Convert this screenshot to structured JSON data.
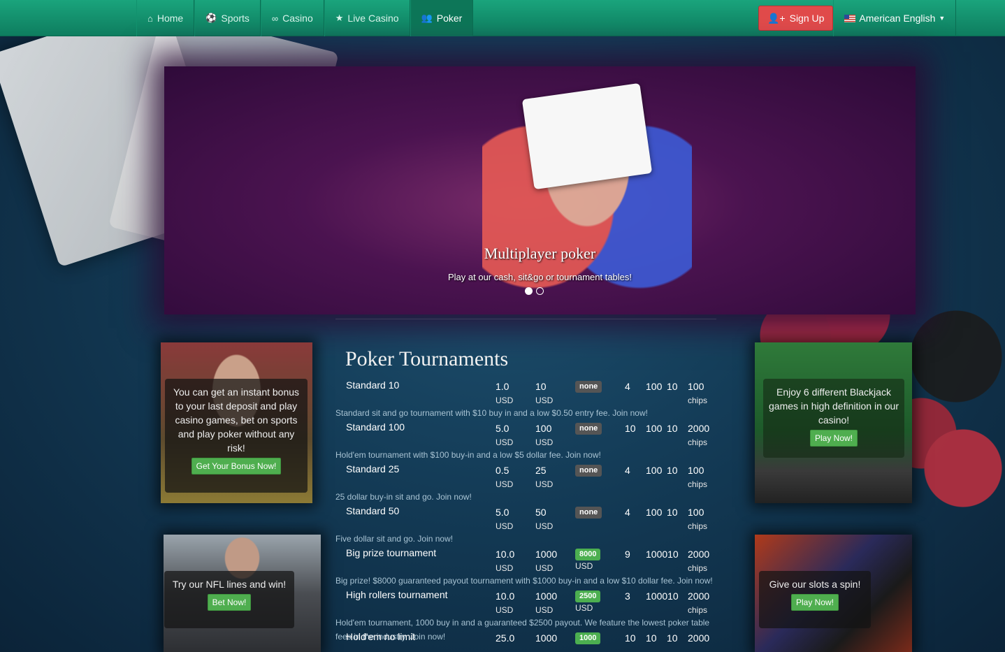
{
  "nav": {
    "items": [
      {
        "label": "Home",
        "icon": "home-icon"
      },
      {
        "label": "Sports",
        "icon": "soccer-ball-icon"
      },
      {
        "label": "Casino",
        "icon": "link-icon"
      },
      {
        "label": "Live Casino",
        "icon": "star-icon"
      },
      {
        "label": "Poker",
        "icon": "users-icon"
      }
    ],
    "signup_label": "Sign Up",
    "language_label": "American English"
  },
  "slider": {
    "title": "Multiplayer poker",
    "subtitle": "Play at our cash, sit&go or tournament tables!"
  },
  "left_promos": [
    {
      "text": "You can get an instant bonus to your last deposit and play casino games, bet on sports and play poker without any risk!",
      "button": "Get Your Bonus Now!"
    },
    {
      "text": "Try our NFL lines and win!",
      "button": "Bet Now!"
    }
  ],
  "right_promos": [
    {
      "text": "Enjoy 6 different Blackjack games in high definition in our casino!",
      "button": "Play Now!"
    },
    {
      "text": "Give our slots a spin!",
      "button": "Play Now!"
    }
  ],
  "tournaments": {
    "title": "Poker Tournaments",
    "rows": [
      {
        "name": "Standard 10",
        "buyin": "1.0",
        "buyin_unit": "USD",
        "prize": "10",
        "prize_unit": "USD",
        "guarantee": "none",
        "guarantee_style": "none",
        "players": "4",
        "c1": "100",
        "c2": "10",
        "chips": "100",
        "chips_unit": "chips",
        "desc": "Standard sit and go tournament with $10 buy in and a low $0.50 entry fee. Join now!"
      },
      {
        "name": "Standard 100",
        "buyin": "5.0",
        "buyin_unit": "USD",
        "prize": "100",
        "prize_unit": "USD",
        "guarantee": "none",
        "guarantee_style": "none",
        "players": "10",
        "c1": "100",
        "c2": "10",
        "chips": "2000",
        "chips_unit": "chips",
        "desc": "Hold'em tournament with $100 buy-in and a low $5 dollar fee. Join now!"
      },
      {
        "name": "Standard 25",
        "buyin": "0.5",
        "buyin_unit": "USD",
        "prize": "25",
        "prize_unit": "USD",
        "guarantee": "none",
        "guarantee_style": "none",
        "players": "4",
        "c1": "100",
        "c2": "10",
        "chips": "100",
        "chips_unit": "chips",
        "desc": "25 dollar buy-in sit and go. Join now!"
      },
      {
        "name": "Standard 50",
        "buyin": "5.0",
        "buyin_unit": "USD",
        "prize": "50",
        "prize_unit": "USD",
        "guarantee": "none",
        "guarantee_style": "none",
        "players": "4",
        "c1": "100",
        "c2": "10",
        "chips": "100",
        "chips_unit": "chips",
        "desc": "Five dollar sit and go. Join now!"
      },
      {
        "name": "Big prize tournament",
        "buyin": "10.0",
        "buyin_unit": "USD",
        "prize": "1000",
        "prize_unit": "USD",
        "guarantee": "8000",
        "guarantee_style": "green",
        "guarantee_unit": "USD",
        "players": "9",
        "c1": "100010",
        "c2": "",
        "chips": "2000",
        "chips_unit": "chips",
        "desc": "Big prize! $8000 guaranteed payout tournament with $1000 buy-in and a low $10 dollar fee. Join now!"
      },
      {
        "name": "High rollers tournament",
        "buyin": "10.0",
        "buyin_unit": "USD",
        "prize": "1000",
        "prize_unit": "USD",
        "guarantee": "2500",
        "guarantee_style": "green",
        "guarantee_unit": "USD",
        "players": "3",
        "c1": "100010",
        "c2": "",
        "chips": "2000",
        "chips_unit": "chips",
        "desc": "Hold'em tournament, 1000 buy in and a guaranteed $2500 payout. We feature the lowest poker table fees in the industry. Join now!"
      },
      {
        "name": "Hold'em no limit",
        "buyin": "25.0",
        "buyin_unit": "",
        "prize": "1000",
        "prize_unit": "",
        "guarantee": "1000",
        "guarantee_style": "green",
        "players": "10",
        "c1": "10",
        "c2": "10",
        "chips": "2000",
        "chips_unit": "",
        "desc": ""
      }
    ]
  }
}
